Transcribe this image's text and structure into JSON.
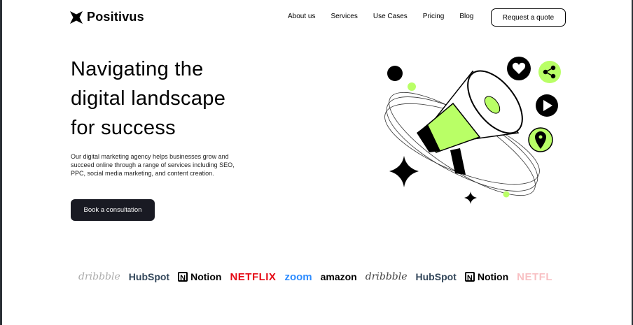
{
  "nav": {
    "logo_text": "Positivus",
    "links": [
      "About us",
      "Services",
      "Use Cases",
      "Pricing",
      "Blog"
    ],
    "cta": "Request a quote"
  },
  "hero": {
    "title_lines": [
      "Navigating the",
      "digital landscape",
      "for success"
    ],
    "description": "Our digital marketing agency helps businesses grow and succeed online through a range of services including SEO, PPC, social media marketing, and content creation.",
    "button": "Book a consultation"
  },
  "brands": [
    "dribbble",
    "HubSpot",
    "Notion",
    "NETFLIX",
    "zoom",
    "amazon",
    "dribbble",
    "HubSpot",
    "Notion",
    "NETFL"
  ],
  "colors": {
    "accent": "#b9ff66",
    "dark": "#191a23"
  }
}
